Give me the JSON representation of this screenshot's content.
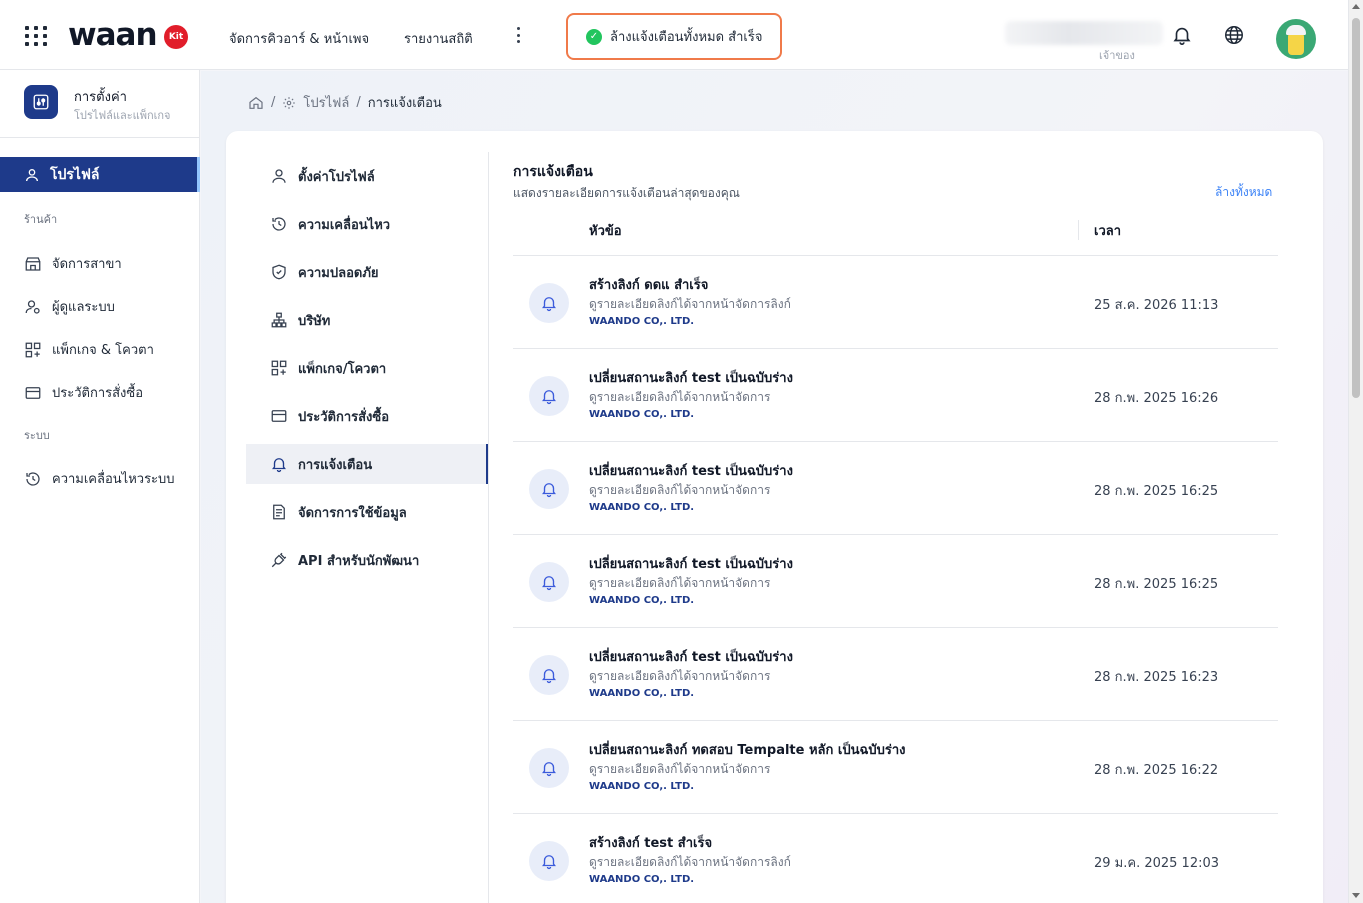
{
  "topbar": {
    "logo": "waan",
    "logo_badge": "Kit",
    "nav": [
      "จัดการคิวอาร์ & หน้าเพจ",
      "รายงานสถิติ"
    ],
    "toast": "ล้างแจ้งเตือนทั้งหมด สำเร็จ",
    "owner_label": "เจ้าของ"
  },
  "sidebar": {
    "title": "การตั้งค่า",
    "subtitle": "โปรไฟล์และแพ็กเกจ",
    "active": "โปรไฟล์",
    "section_shop": "ร้านค้า",
    "shop_items": [
      "จัดการสาขา",
      "ผู้ดูแลระบบ",
      "แพ็กเกจ & โควตา",
      "ประวัติการสั่งซื้อ"
    ],
    "section_system": "ระบบ",
    "system_items": [
      "ความเคลื่อนไหวระบบ"
    ]
  },
  "breadcrumb": {
    "profile": "โปรไฟล์",
    "current": "การแจ้งเตือน"
  },
  "menu": [
    {
      "label": "ตั้งค่าโปรไฟล์",
      "icon": "user-icon"
    },
    {
      "label": "ความเคลื่อนไหว",
      "icon": "history-icon"
    },
    {
      "label": "ความปลอดภัย",
      "icon": "shield-icon"
    },
    {
      "label": "บริษัท",
      "icon": "org-icon"
    },
    {
      "label": "แพ็กเกจ/โควตา",
      "icon": "package-icon"
    },
    {
      "label": "ประวัติการสั่งซื้อ",
      "icon": "card-icon"
    },
    {
      "label": "การแจ้งเตือน",
      "icon": "bell-icon"
    },
    {
      "label": "จัดการการใช้ข้อมูล",
      "icon": "document-icon"
    },
    {
      "label": "API สำหรับนักพัฒนา",
      "icon": "plug-icon"
    }
  ],
  "notifications": {
    "title": "การแจ้งเตือน",
    "subtitle": "แสดงรายละเอียดการแจ้งเตือนล่าสุดของคุณ",
    "clear_all": "ล้างทั้งหมด",
    "col_topic": "หัวข้อ",
    "col_time": "เวลา",
    "rows": [
      {
        "title": "สร้างลิงก์ ดดแ สำเร็จ",
        "desc": "ดูรายละเอียดลิงก์ได้จากหน้าจัดการลิงก์",
        "company": "WAANDO CO,. LTD.",
        "time": "25 ส.ค. 2026 11:13"
      },
      {
        "title": "เปลี่ยนสถานะลิงก์ test เป็นฉบับร่าง",
        "desc": "ดูรายละเอียดลิงก์ได้จากหน้าจัดการ",
        "company": "WAANDO CO,. LTD.",
        "time": "28 ก.พ. 2025 16:26"
      },
      {
        "title": "เปลี่ยนสถานะลิงก์ test เป็นฉบับร่าง",
        "desc": "ดูรายละเอียดลิงก์ได้จากหน้าจัดการ",
        "company": "WAANDO CO,. LTD.",
        "time": "28 ก.พ. 2025 16:25"
      },
      {
        "title": "เปลี่ยนสถานะลิงก์ test เป็นฉบับร่าง",
        "desc": "ดูรายละเอียดลิงก์ได้จากหน้าจัดการ",
        "company": "WAANDO CO,. LTD.",
        "time": "28 ก.พ. 2025 16:25"
      },
      {
        "title": "เปลี่ยนสถานะลิงก์ test เป็นฉบับร่าง",
        "desc": "ดูรายละเอียดลิงก์ได้จากหน้าจัดการ",
        "company": "WAANDO CO,. LTD.",
        "time": "28 ก.พ. 2025 16:23"
      },
      {
        "title": "เปลี่ยนสถานะลิงก์ ทดสอบ Tempalte หลัก เป็นฉบับร่าง",
        "desc": "ดูรายละเอียดลิงก์ได้จากหน้าจัดการ",
        "company": "WAANDO CO,. LTD.",
        "time": "28 ก.พ. 2025 16:22"
      },
      {
        "title": "สร้างลิงก์ test สำเร็จ",
        "desc": "ดูรายละเอียดลิงก์ได้จากหน้าจัดการลิงก์",
        "company": "WAANDO CO,. LTD.",
        "time": "29 ม.ค. 2025 12:03"
      }
    ]
  },
  "colors": {
    "brand_navy": "#1e3a8a",
    "toast_border": "#f07a4a",
    "success": "#22c55e",
    "link": "#3b82f6"
  }
}
